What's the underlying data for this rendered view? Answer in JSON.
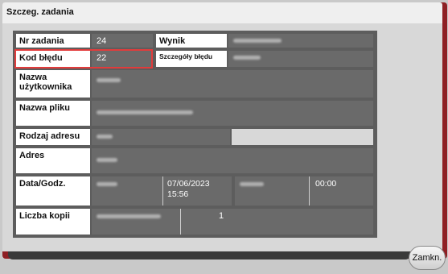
{
  "window": {
    "title": "Szczeg. zadania"
  },
  "rows": {
    "job_number": {
      "label": "Nr zadania",
      "value": "24"
    },
    "result": {
      "label": "Wynik"
    },
    "error_code": {
      "label": "Kod błędu",
      "value": "22"
    },
    "error_details": {
      "label": "Szczegóły błędu"
    },
    "user_name": {
      "label": "Nazwa użytkownika"
    },
    "file_name": {
      "label": "Nazwa pliku"
    },
    "address_type": {
      "label": "Rodzaj adresu"
    },
    "address": {
      "label": "Adres"
    },
    "date_time": {
      "label": "Data/Godz.",
      "date": "07/06/2023",
      "time": "15:56",
      "end_time": "00:00"
    },
    "copies": {
      "label": "Liczba kopii",
      "value": "1"
    }
  },
  "buttons": {
    "close": "Zamkn."
  },
  "colors": {
    "frame": "#8e1f24",
    "highlight": "#e23b3b"
  }
}
